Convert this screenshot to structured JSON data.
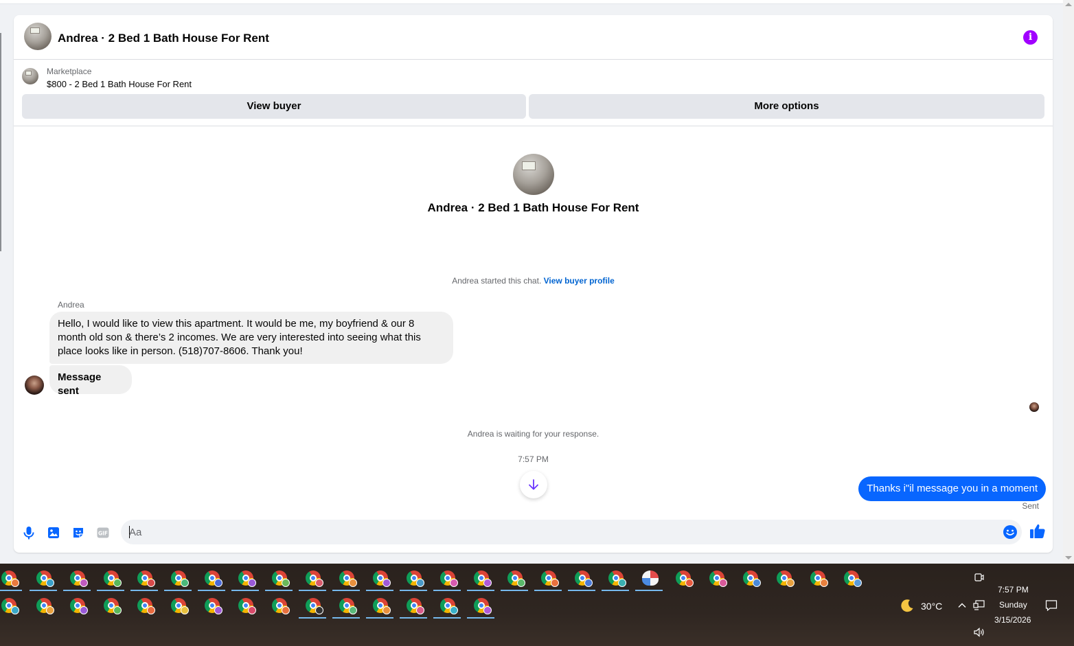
{
  "conversation": {
    "title": "Andrea · 2 Bed 1 Bath House For Rent",
    "listing": {
      "label": "Marketplace",
      "price_title": "$800 - 2 Bed 1 Bath House For Rent"
    },
    "buttons": {
      "view_buyer": "View buyer",
      "more_options": "More options"
    },
    "intro_title": "Andrea · 2 Bed 1 Bath House For Rent",
    "started_text": "Andrea started this chat.",
    "started_link": "View buyer profile",
    "sender_name": "Andrea",
    "messages": [
      "Hello, I would like to view this apartment. It would be me, my boyfriend & our 8 month old son & there’s 2 incomes. We are very interested into seeing what this place looks like in person. (518)707-8606. Thank you!",
      "Message sent"
    ],
    "waiting_text": "Andrea is waiting for your response.",
    "timestamp": "7:57 PM",
    "outgoing_message": "Thanks i\"il message you in a moment",
    "sent_status": "Sent",
    "composer_placeholder": "Aa"
  },
  "colors": {
    "accent": "#0866ff",
    "info": "#a100ff",
    "link": "#0064d1"
  },
  "taskbar": {
    "weather_temp": "30°C",
    "time": "7:57 PM",
    "day": "Sunday",
    "date": "3/15/2026"
  }
}
